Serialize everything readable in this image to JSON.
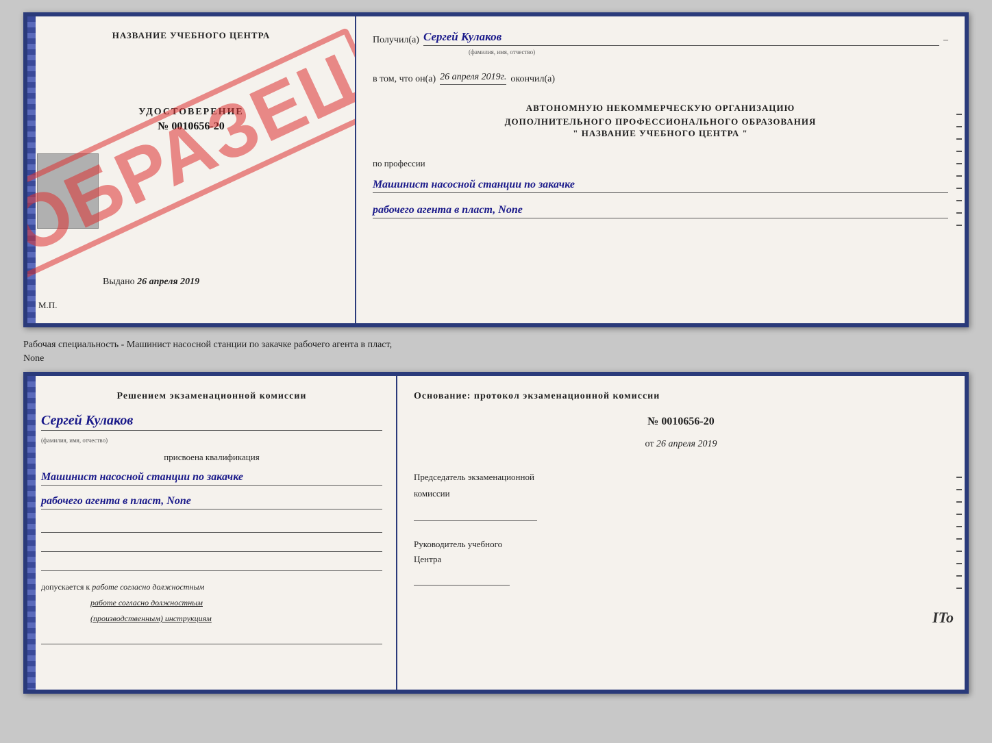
{
  "top_document": {
    "left": {
      "center_title": "НАЗВАНИЕ УЧЕБНОГО ЦЕНТРА",
      "obrazets": "ОБРАЗЕЦ",
      "udostoverenie_label": "УДОСТОВЕРЕНИЕ",
      "udostoverenie_num": "№ 0010656-20",
      "vydano_prefix": "Выдано",
      "vydano_date": "26 апреля 2019",
      "mp_label": "М.П."
    },
    "right": {
      "poluchil_prefix": "Получил(а)",
      "poluchil_name": "Сергей Кулаков",
      "fio_hint": "(фамилия, имя, отчество)",
      "dash": "–",
      "vtom_prefix": "в том, что он(а)",
      "vtom_date": "26 апреля 2019г.",
      "okonchil": "окончил(а)",
      "org_line1": "АВТОНОМНУЮ НЕКОММЕРЧЕСКУЮ ОРГАНИЗАЦИЮ",
      "org_line2": "ДОПОЛНИТЕЛЬНОГО ПРОФЕССИОНАЛЬНОГО ОБРАЗОВАНИЯ",
      "org_name": "\"  НАЗВАНИЕ УЧЕБНОГО ЦЕНТРА  \"",
      "po_professii": "по профессии",
      "profession_line1": "Машинист насосной станции по закачке",
      "profession_line2": "рабочего агента в пласт, None"
    }
  },
  "separator": {
    "text1": "Рабочая специальность - Машинист насосной станции по закачке рабочего агента в пласт,",
    "text2": "None"
  },
  "bottom_document": {
    "left": {
      "resheniem_line": "Решением  экзаменационной  комиссии",
      "person_name": "Сергей Кулаков",
      "fio_hint": "(фамилия, имя, отчество)",
      "prisvoena_label": "присвоена квалификация",
      "qualification_line1": "Машинист насосной станции по закачке",
      "qualification_line2": "рабочего агента в пласт, None",
      "dopuskaetsya_prefix": "допускается к",
      "dopuskaetsya_text": "работе согласно должностным",
      "dopuskaetsya_text2": "(производственным) инструкциям"
    },
    "right": {
      "osnovanie_title": "Основание: протокол экзаменационной  комиссии",
      "protocol_num": "№  0010656-20",
      "ot_prefix": "от",
      "protocol_date": "26 апреля 2019",
      "predsedatel_label1": "Председатель экзаменационной",
      "predsedatel_label2": "комиссии",
      "rukovoditel_label1": "Руководитель учебного",
      "rukovoditel_label2": "Центра",
      "ito_text": "ITo"
    }
  }
}
